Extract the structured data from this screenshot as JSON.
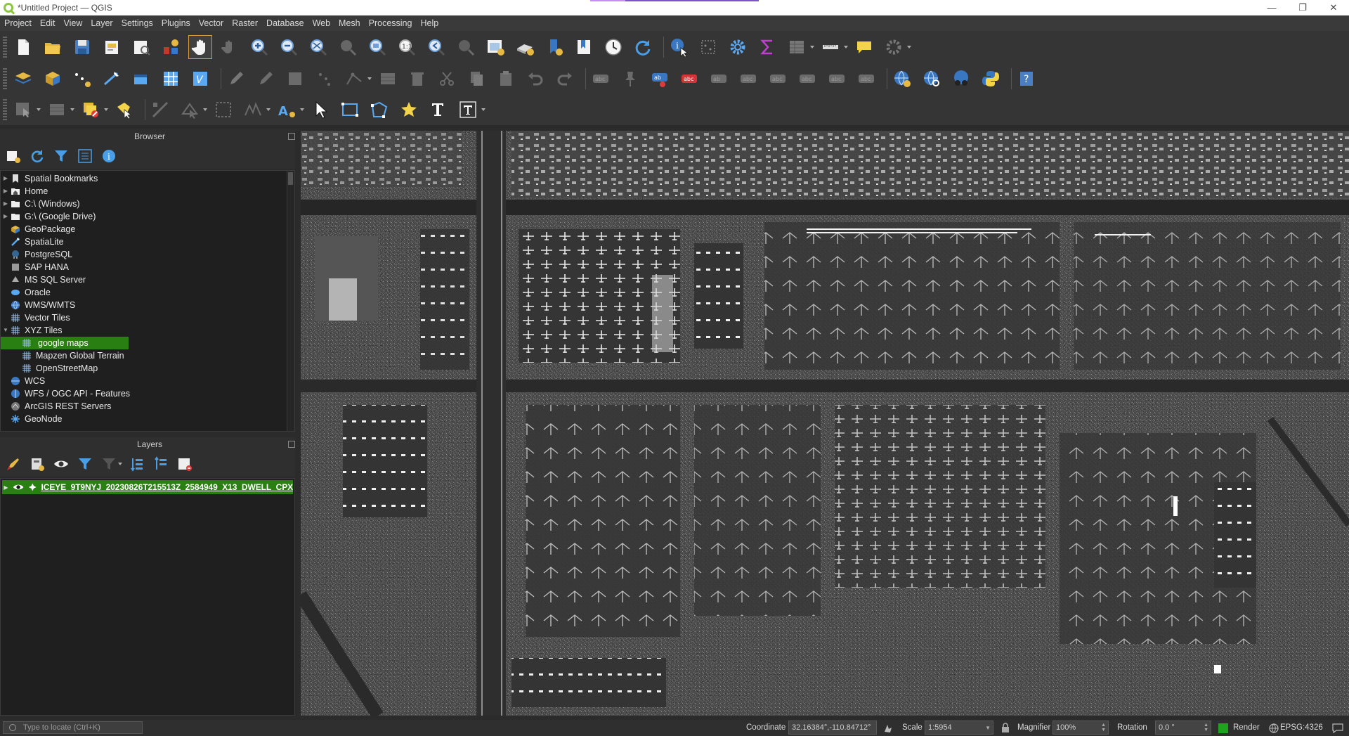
{
  "window": {
    "title": "*Untitled Project — QGIS",
    "controls": [
      "—",
      "❐",
      "✕"
    ]
  },
  "menu": [
    "Project",
    "Edit",
    "View",
    "Layer",
    "Settings",
    "Plugins",
    "Vector",
    "Raster",
    "Database",
    "Web",
    "Mesh",
    "Processing",
    "Help"
  ],
  "browser": {
    "title": "Browser",
    "items": [
      {
        "label": "Spatial Bookmarks",
        "icon": "bookmark-icon",
        "expandable": true
      },
      {
        "label": "Home",
        "icon": "home-folder-icon",
        "expandable": true
      },
      {
        "label": "C:\\ (Windows)",
        "icon": "drive-icon",
        "expandable": true
      },
      {
        "label": "G:\\ (Google Drive)",
        "icon": "drive-icon",
        "expandable": true
      },
      {
        "label": "GeoPackage",
        "icon": "geopackage-icon",
        "expandable": false
      },
      {
        "label": "SpatiaLite",
        "icon": "spatialite-icon",
        "expandable": false
      },
      {
        "label": "PostgreSQL",
        "icon": "postgresql-icon",
        "expandable": false
      },
      {
        "label": "SAP HANA",
        "icon": "sap-hana-icon",
        "expandable": false
      },
      {
        "label": "MS SQL Server",
        "icon": "mssql-icon",
        "expandable": false
      },
      {
        "label": "Oracle",
        "icon": "oracle-icon",
        "expandable": false
      },
      {
        "label": "WMS/WMTS",
        "icon": "wms-icon",
        "expandable": false
      },
      {
        "label": "Vector Tiles",
        "icon": "vector-tiles-icon",
        "expandable": false
      },
      {
        "label": "XYZ Tiles",
        "icon": "xyz-tiles-icon",
        "expandable": true,
        "expanded": true
      },
      {
        "label": "google maps",
        "icon": "xyz-tiles-icon",
        "child": true,
        "selected": true
      },
      {
        "label": "Mapzen Global Terrain",
        "icon": "xyz-tiles-icon",
        "child": true
      },
      {
        "label": "OpenStreetMap",
        "icon": "xyz-tiles-icon",
        "child": true
      },
      {
        "label": "WCS",
        "icon": "wcs-icon",
        "expandable": false
      },
      {
        "label": "WFS / OGC API - Features",
        "icon": "wfs-icon",
        "expandable": false
      },
      {
        "label": "ArcGIS REST Servers",
        "icon": "arcgis-icon",
        "expandable": false
      },
      {
        "label": "GeoNode",
        "icon": "geonode-icon",
        "expandable": false
      }
    ]
  },
  "layers": {
    "title": "Layers",
    "items": [
      {
        "name": "ICEYE_9T9NYJ_20230826T215513Z_2584949_X13_DWELL_CPX",
        "visible": true
      }
    ]
  },
  "statusbar": {
    "locate_placeholder": "Type to locate (Ctrl+K)",
    "coordinate_label": "Coordinate",
    "coordinate_value": "32.16384°,-110.84712°",
    "scale_label": "Scale",
    "scale_value": "1:5954",
    "magnifier_label": "Magnifier",
    "magnifier_value": "100%",
    "rotation_label": "Rotation",
    "rotation_value": "0.0 °",
    "render_label": "Render",
    "crs_label": "EPSG:4326"
  },
  "colors": {
    "selection_green": "#2a7f12",
    "render_green": "#1fa31f",
    "accent_orange": "#d99a3b"
  }
}
